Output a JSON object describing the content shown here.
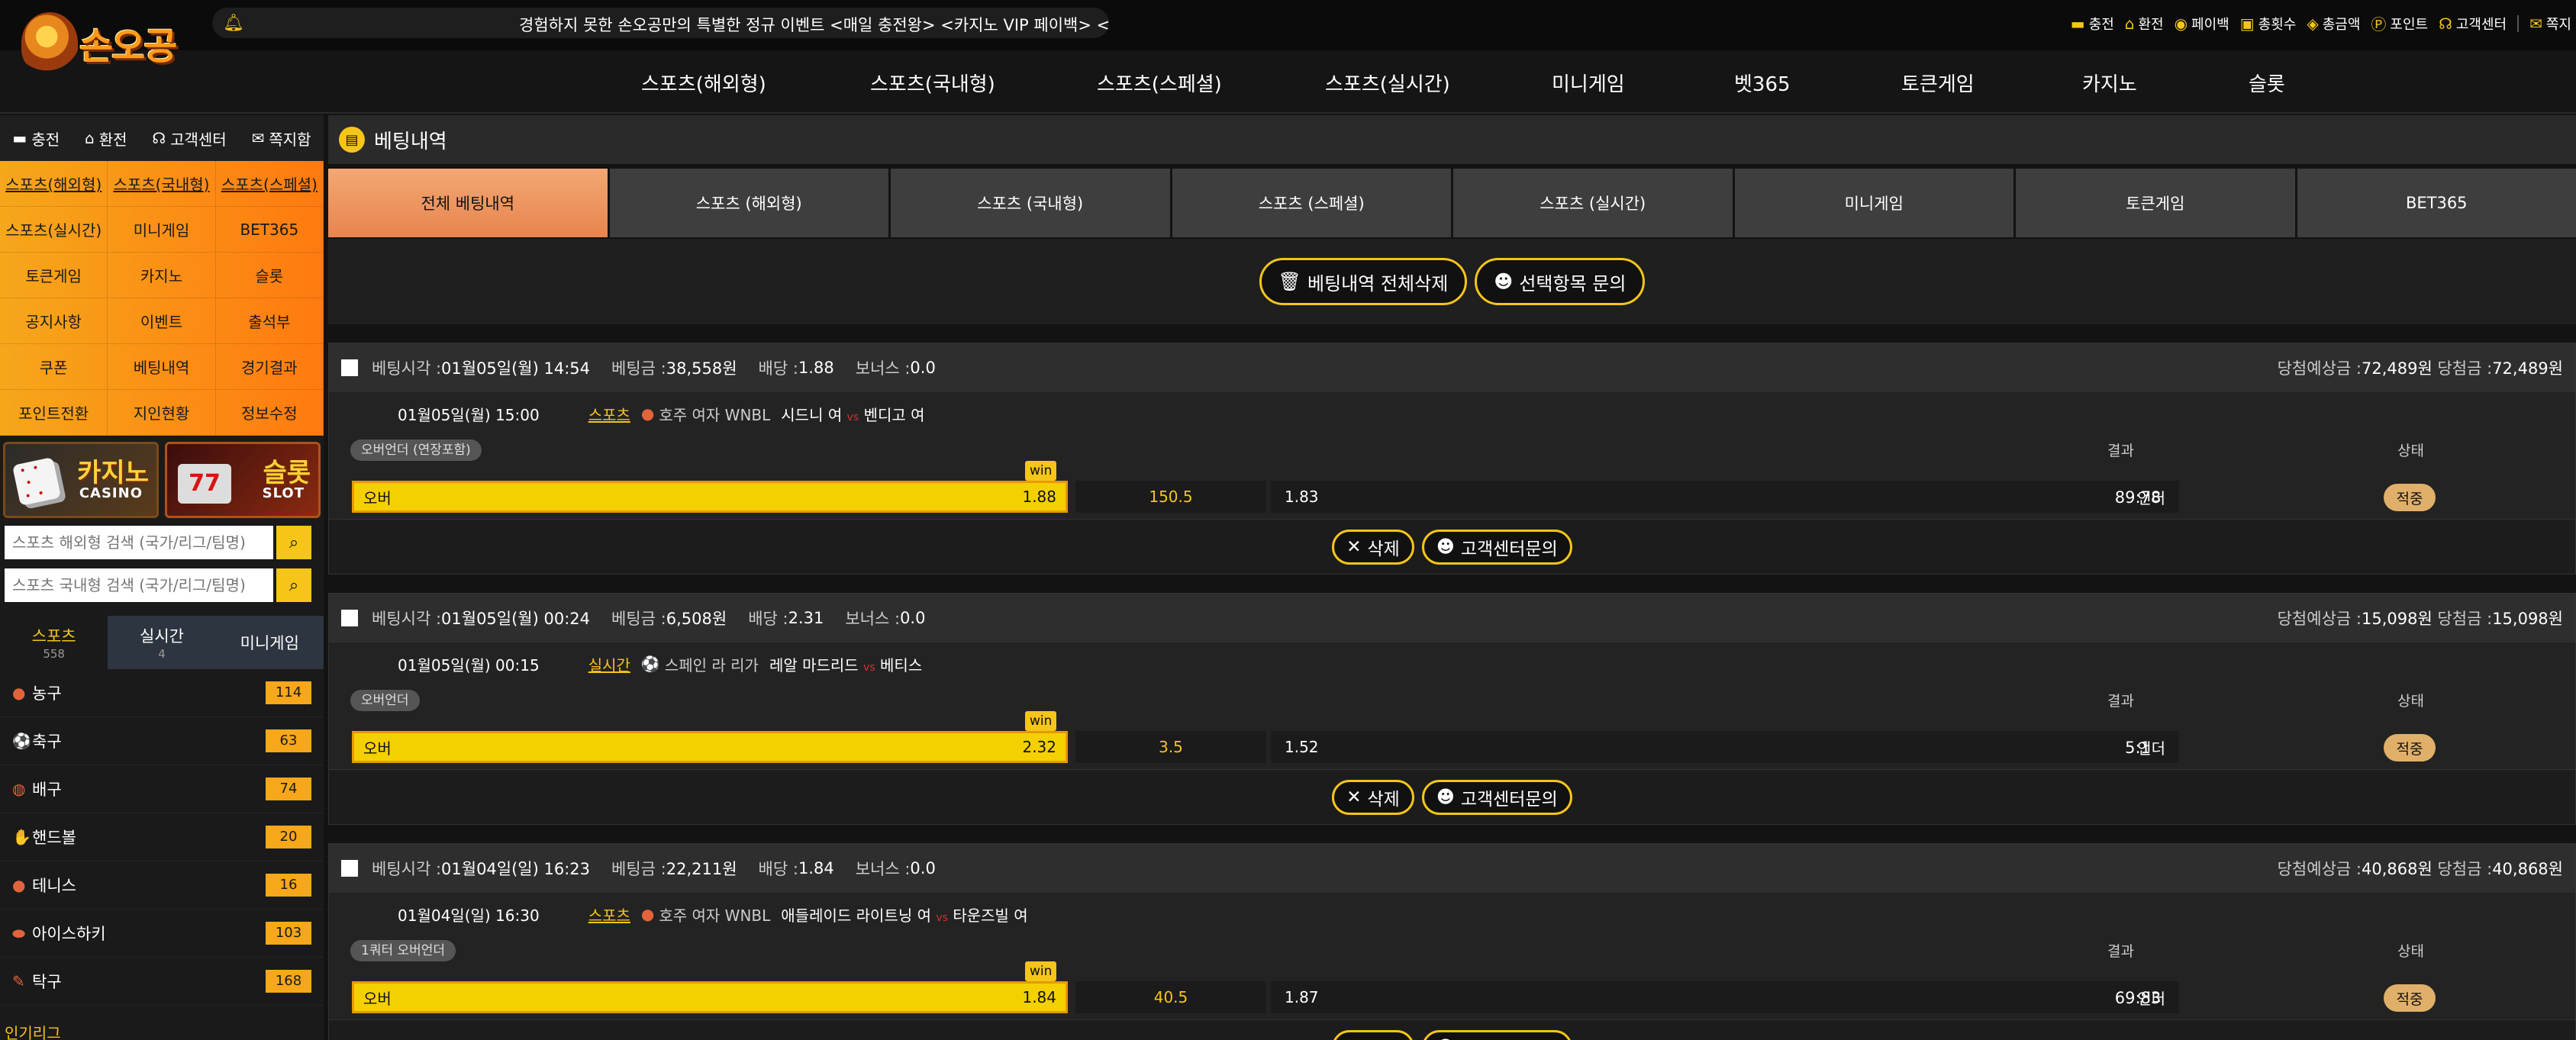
{
  "header": {
    "logo_text": "손오공",
    "notice": "경험하지 못한 손오공만의 특별한 정규 이벤트 <매일 충전왕> <카지노 VIP 페이백> <무한 입",
    "util": [
      {
        "icon": "card-icon",
        "glyph": "▬",
        "label": "충전"
      },
      {
        "icon": "bank-icon",
        "glyph": "⌂",
        "label": "환전"
      },
      {
        "icon": "coin-icon",
        "glyph": "◉",
        "label": "페이백"
      },
      {
        "icon": "coupon-icon",
        "glyph": "▣",
        "label": "총횟수"
      },
      {
        "icon": "money-icon",
        "glyph": "◈",
        "label": "총금액"
      },
      {
        "icon": "point-icon",
        "glyph": "Ⓟ",
        "label": "포인트"
      },
      {
        "icon": "headset-icon",
        "glyph": "☊",
        "label": "고객센터"
      },
      {
        "icon": "message-icon",
        "glyph": "✉",
        "label": "쪽지"
      }
    ]
  },
  "nav": [
    "스포츠(해외형)",
    "스포츠(국내형)",
    "스포츠(스페셜)",
    "스포츠(실시간)",
    "미니게임",
    "벳365",
    "토큰게임",
    "카지노",
    "슬롯"
  ],
  "sidebar": {
    "quick": [
      {
        "icon": "card-icon",
        "glyph": "▬",
        "label": "충전"
      },
      {
        "icon": "bank-icon",
        "glyph": "⌂",
        "label": "환전"
      },
      {
        "icon": "headset-icon",
        "glyph": "☊",
        "label": "고객센터"
      },
      {
        "icon": "message-icon",
        "glyph": "✉",
        "label": "쪽지함"
      }
    ],
    "menu": [
      "스포츠(해외형)",
      "스포츠(국내형)",
      "스포츠(스페셜)",
      "스포츠(실시간)",
      "미니게임",
      "BET365",
      "토큰게임",
      "카지노",
      "슬롯",
      "공지사항",
      "이벤트",
      "출석부",
      "쿠폰",
      "베팅내역",
      "경기결과",
      "포인트전환",
      "지인현황",
      "정보수정"
    ],
    "banners": {
      "casino_title": "카지노",
      "casino_sub": "CASINO",
      "slot_title": "슬롯",
      "slot_sub": "SLOT",
      "slot_reel": "77"
    },
    "search_overseas_placeholder": "스포츠 해외형 검색 (국가/리그/팀명)",
    "search_domestic_placeholder": "스포츠 국내형 검색 (국가/리그/팀명)",
    "tabs": [
      {
        "label": "스포츠",
        "count": "558"
      },
      {
        "label": "실시간",
        "count": "4"
      },
      {
        "label": "미니게임",
        "count": ""
      }
    ],
    "sports": [
      {
        "name": "농구",
        "count": "114",
        "icon": "basketball-icon",
        "glyph": "●"
      },
      {
        "name": "축구",
        "count": "63",
        "icon": "soccer-icon",
        "glyph": "⚽"
      },
      {
        "name": "배구",
        "count": "74",
        "icon": "volleyball-icon",
        "glyph": "◍"
      },
      {
        "name": "핸드볼",
        "count": "20",
        "icon": "handball-icon",
        "glyph": "✋"
      },
      {
        "name": "테니스",
        "count": "16",
        "icon": "tennis-icon",
        "glyph": "●"
      },
      {
        "name": "아이스하키",
        "count": "103",
        "icon": "hockey-icon",
        "glyph": "⬬"
      },
      {
        "name": "탁구",
        "count": "168",
        "icon": "pingpong-icon",
        "glyph": "✎"
      }
    ],
    "more": "인기리그"
  },
  "main": {
    "title": "베팅내역",
    "tabs": [
      "전체 베팅내역",
      "스포츠 (해외형)",
      "스포츠 (국내형)",
      "스포츠 (스페셜)",
      "스포츠 (실시간)",
      "미니게임",
      "토큰게임",
      "BET365"
    ],
    "delete_all": "베팅내역 전체삭제",
    "inquire_selected": "선택항목 문의",
    "labels": {
      "bet_time": "베팅시각 :",
      "bet_amount": "베팅금 :",
      "odds": "배당 :",
      "bonus": "보너스 :",
      "expected_win": "당첨예상금 :",
      "win_amount": "당첨금 :",
      "result": "결과",
      "status": "상태",
      "win_tag": "win",
      "delete": "삭제",
      "inquire": "고객센터문의"
    },
    "bets": [
      {
        "time": "01월05일(월) 14:54",
        "amount": "38,558원",
        "odds": "1.88",
        "bonus": "0.0",
        "expected": "72,489원",
        "won": "72,489원",
        "match_time": "01월05일(월) 15:00",
        "type": "스포츠",
        "league": "호주 여자 WNBL",
        "league_icon": "basketball-icon",
        "league_glyph": "●",
        "home": "시드니 여",
        "vs": "vs",
        "away": "벤디고 여",
        "market": "오버언더 (연장포함)",
        "pick": "오버",
        "pick_odds": "1.88",
        "base": "150.5",
        "other_odds": "1.83",
        "other": "언더",
        "score": "89:78",
        "status": "적중"
      },
      {
        "time": "01월05일(월) 00:24",
        "amount": "6,508원",
        "odds": "2.31",
        "bonus": "0.0",
        "expected": "15,098원",
        "won": "15,098원",
        "match_time": "01월05일(월) 00:15",
        "type": "실시간",
        "league": "스페인 라 리가",
        "league_icon": "soccer-icon",
        "league_glyph": "⚽",
        "home": "레알 마드리드",
        "vs": "vs",
        "away": "베티스",
        "market": "오버언더",
        "pick": "오버",
        "pick_odds": "2.32",
        "base": "3.5",
        "other_odds": "1.52",
        "other": "언더",
        "score": "5:1",
        "status": "적중"
      },
      {
        "time": "01월04일(일) 16:23",
        "amount": "22,211원",
        "odds": "1.84",
        "bonus": "0.0",
        "expected": "40,868원",
        "won": "40,868원",
        "match_time": "01월04일(일) 16:30",
        "type": "스포츠",
        "league": "호주 여자 WNBL",
        "league_icon": "basketball-icon",
        "league_glyph": "●",
        "home": "애들레이드 라이트닝 여",
        "vs": "vs",
        "away": "타운즈빌 여",
        "market": "1쿼터 오버언더",
        "pick": "오버",
        "pick_odds": "1.84",
        "base": "40.5",
        "other_odds": "1.87",
        "other": "언더",
        "score": "69:83",
        "status": "적중"
      }
    ]
  }
}
